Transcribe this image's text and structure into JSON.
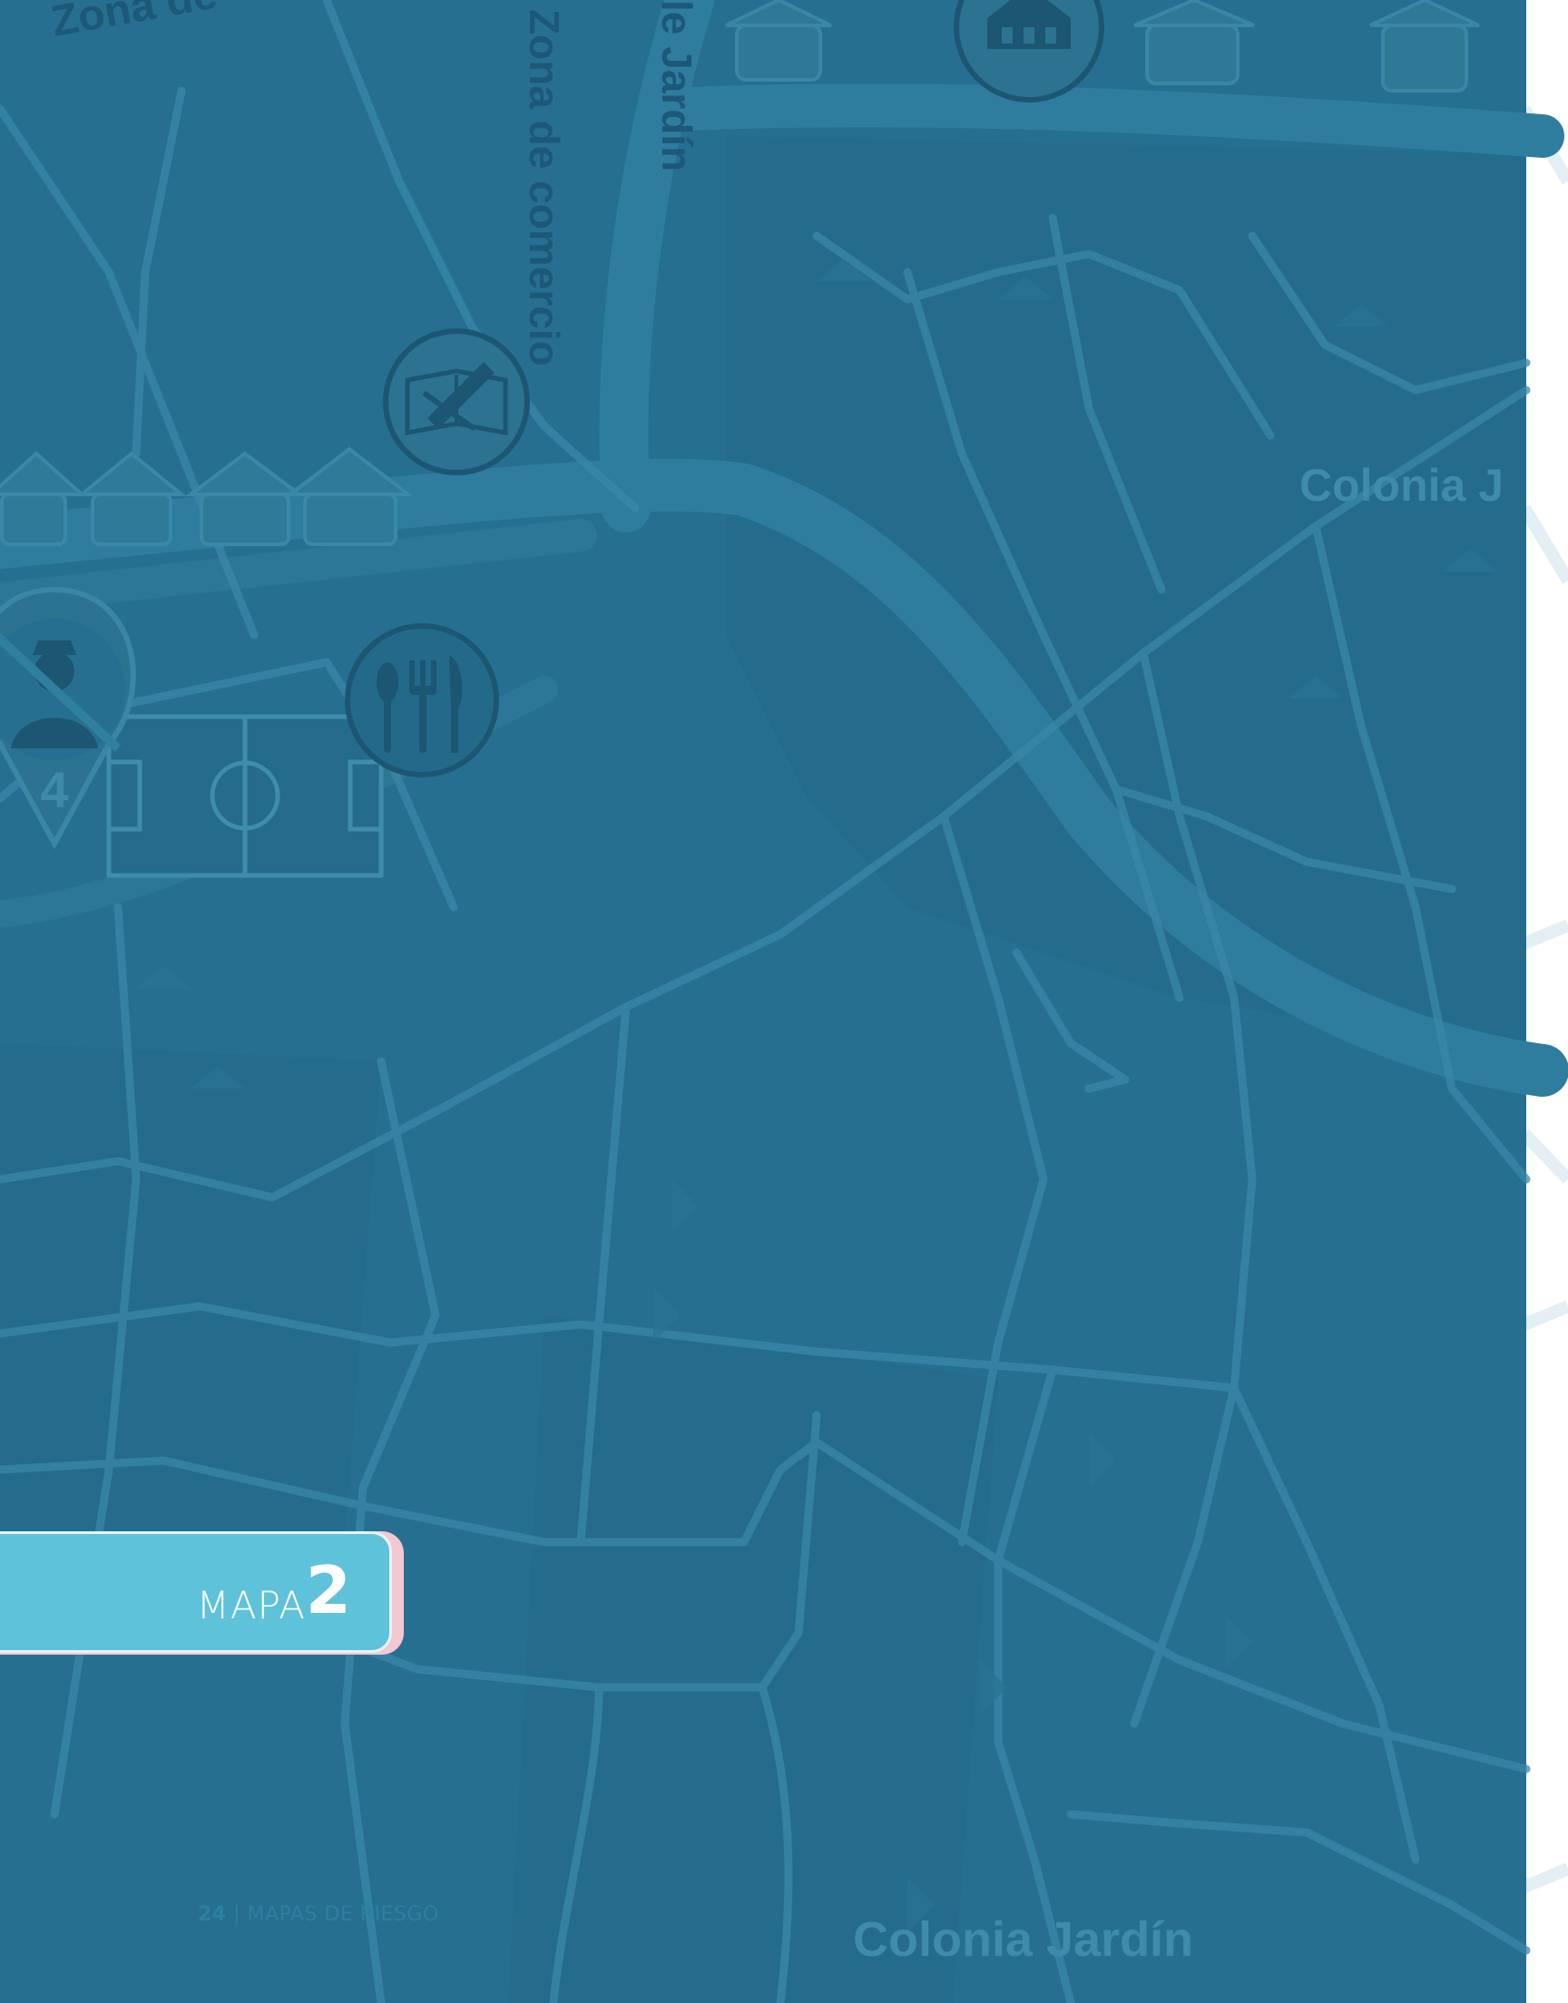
{
  "map": {
    "labels": {
      "zona_top": "Zona de",
      "zona_comercio": "Zona de comercio",
      "jardin_vertical": "le Jardín",
      "colonia_right": "Colonia J",
      "colonia_bottom": "Colonia Jardín"
    },
    "police_number": "4",
    "icons": [
      "school-icon",
      "restaurant-icon",
      "police-icon",
      "church-icon",
      "soccer-field-icon",
      "house-icon"
    ]
  },
  "tab": {
    "word": "MAPA",
    "number": "2"
  },
  "footer": {
    "page": "24",
    "separator": "|",
    "title": "MAPAS DE RIESGO"
  },
  "colors": {
    "background": "#266f91",
    "road": "#2f7d9e",
    "tab": "#5ec2da",
    "tab_accent": "#f3c8d2"
  }
}
